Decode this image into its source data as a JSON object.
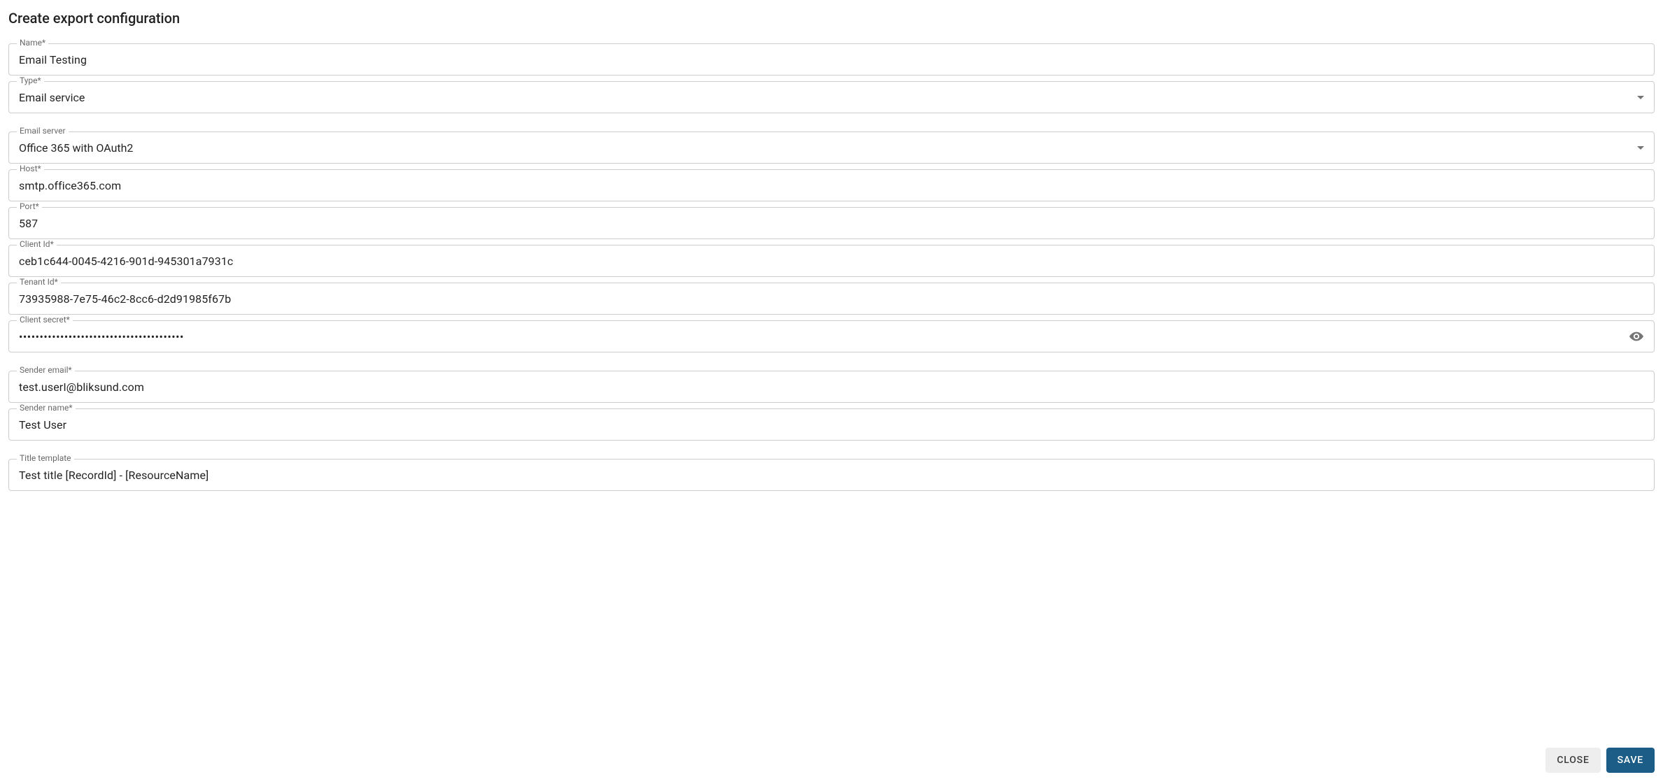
{
  "title": "Create export configuration",
  "fields": {
    "name": {
      "label": "Name*",
      "value": "Email Testing"
    },
    "type": {
      "label": "Type*",
      "value": "Email service"
    },
    "emailServer": {
      "label": "Email server",
      "value": "Office 365 with OAuth2"
    },
    "host": {
      "label": "Host*",
      "value": "smtp.office365.com"
    },
    "port": {
      "label": "Port*",
      "value": "587"
    },
    "clientId": {
      "label": "Client Id*",
      "value": "ceb1c644-0045-4216-901d-945301a7931c"
    },
    "tenantId": {
      "label": "Tenant Id*",
      "value": "73935988-7e75-46c2-8cc6-d2d91985f67b"
    },
    "clientSecret": {
      "label": "Client secret*",
      "masked": "••••••••••••••••••••••••••••••••••••••••"
    },
    "senderEmail": {
      "label": "Sender email*",
      "value": "test.userI@bliksund.com"
    },
    "senderName": {
      "label": "Sender name*",
      "value": "Test User"
    },
    "titleTemplate": {
      "label": "Title template",
      "value": "Test title [RecordId] - [ResourceName]"
    }
  },
  "buttons": {
    "close": "CLOSE",
    "save": "SAVE"
  }
}
